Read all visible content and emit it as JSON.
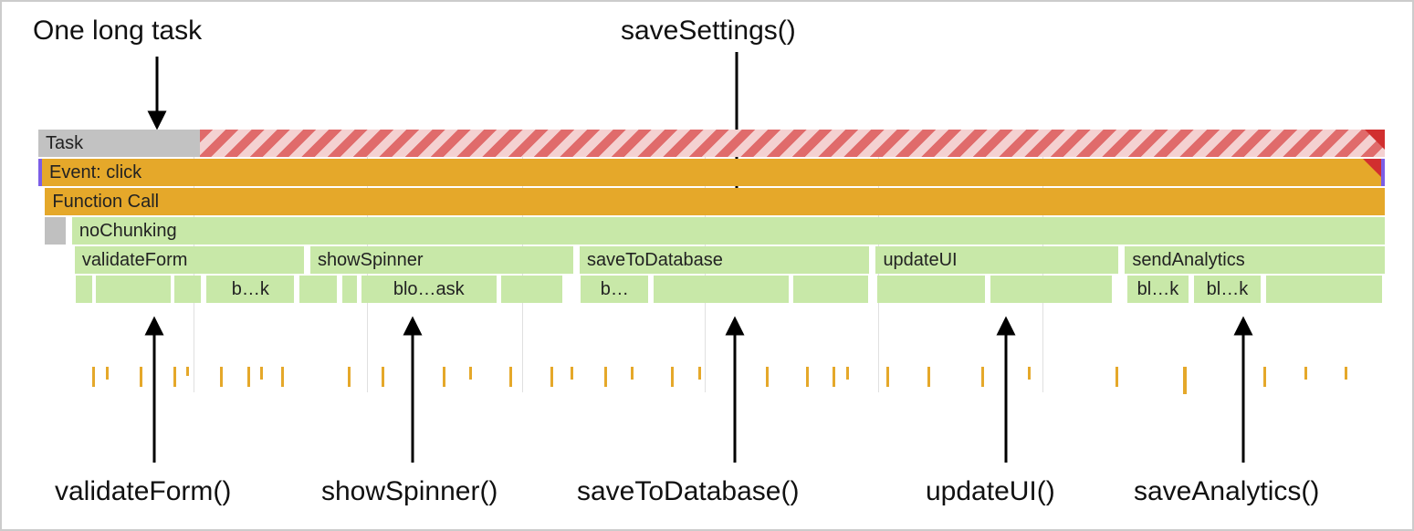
{
  "annotations": {
    "top_left": "One long task",
    "top_right": "saveSettings()",
    "bottom": {
      "a1": "validateForm()",
      "a2": "showSpinner()",
      "a3": "saveToDatabase()",
      "a4": "updateUI()",
      "a5": "saveAnalytics()"
    }
  },
  "rows": {
    "task": "Task",
    "event": "Event: click",
    "func": "Function Call",
    "nochunk": "noChunking",
    "children": {
      "c1": "validateForm",
      "c2": "showSpinner",
      "c3": "saveToDatabase",
      "c4": "updateUI",
      "c5": "sendAnalytics"
    },
    "leaves": {
      "l1": "b…k",
      "l2": "blo…ask",
      "l3": "b…",
      "l4": "bl…k",
      "l5": "bl…k"
    }
  }
}
